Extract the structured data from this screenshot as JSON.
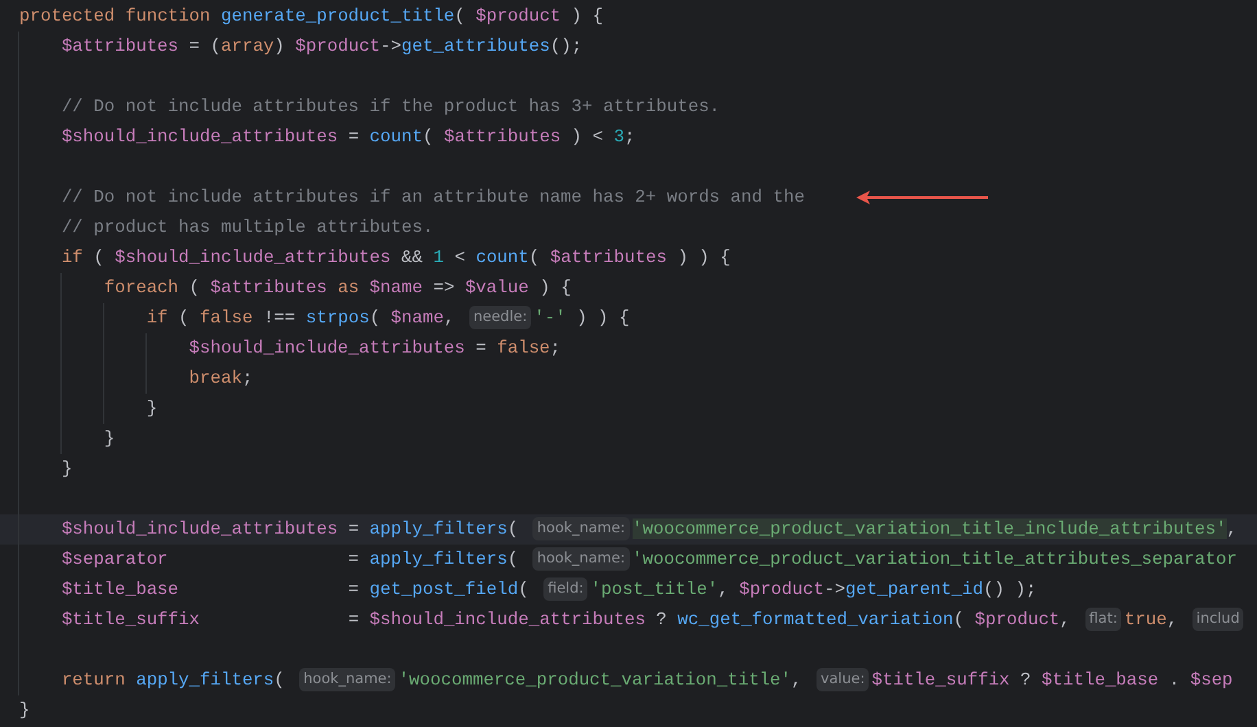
{
  "editor": {
    "lines": [
      {
        "kind": "code",
        "tokens": [
          {
            "kind": "keyword",
            "text": "protected "
          },
          {
            "kind": "keyword",
            "text": "function "
          },
          {
            "kind": "function",
            "text": "generate_product_title"
          },
          {
            "kind": "plain",
            "text": "( "
          },
          {
            "kind": "variable",
            "text": "$product"
          },
          {
            "kind": "plain",
            "text": " ) {"
          }
        ],
        "children": [
          {
            "kind": "code",
            "tokens": [
              {
                "kind": "variable",
                "text": "$attributes"
              },
              {
                "kind": "plain",
                "text": " = ("
              },
              {
                "kind": "keyword",
                "text": "array"
              },
              {
                "kind": "plain",
                "text": ") "
              },
              {
                "kind": "variable",
                "text": "$product"
              },
              {
                "kind": "plain",
                "text": "->"
              },
              {
                "kind": "function",
                "text": "get_attributes"
              },
              {
                "kind": "plain",
                "text": "();"
              }
            ]
          },
          {
            "kind": "blank"
          },
          {
            "kind": "code",
            "tokens": [
              {
                "kind": "comment",
                "text": "// Do not include attributes if the product has 3+ attributes."
              }
            ]
          },
          {
            "kind": "code",
            "tokens": [
              {
                "kind": "variable",
                "text": "$should_include_attributes"
              },
              {
                "kind": "plain",
                "text": " = "
              },
              {
                "kind": "function",
                "text": "count"
              },
              {
                "kind": "plain",
                "text": "( "
              },
              {
                "kind": "variable",
                "text": "$attributes"
              },
              {
                "kind": "plain",
                "text": " ) < "
              },
              {
                "kind": "number",
                "text": "3"
              },
              {
                "kind": "plain",
                "text": ";"
              }
            ]
          },
          {
            "kind": "blank"
          },
          {
            "kind": "code",
            "annotated": true,
            "tokens": [
              {
                "kind": "comment",
                "text": "// Do not include attributes if an attribute name has 2+ words and the"
              }
            ]
          },
          {
            "kind": "code",
            "tokens": [
              {
                "kind": "comment",
                "text": "// product has multiple attributes."
              }
            ]
          },
          {
            "kind": "code",
            "tokens": [
              {
                "kind": "keyword",
                "text": "if"
              },
              {
                "kind": "plain",
                "text": " ( "
              },
              {
                "kind": "variable",
                "text": "$should_include_attributes"
              },
              {
                "kind": "plain",
                "text": " && "
              },
              {
                "kind": "number",
                "text": "1"
              },
              {
                "kind": "plain",
                "text": " < "
              },
              {
                "kind": "function",
                "text": "count"
              },
              {
                "kind": "plain",
                "text": "( "
              },
              {
                "kind": "variable",
                "text": "$attributes"
              },
              {
                "kind": "plain",
                "text": " ) ) {"
              }
            ],
            "children": [
              {
                "kind": "code",
                "tokens": [
                  {
                    "kind": "keyword",
                    "text": "foreach"
                  },
                  {
                    "kind": "plain",
                    "text": " ( "
                  },
                  {
                    "kind": "variable",
                    "text": "$attributes "
                  },
                  {
                    "kind": "keyword",
                    "text": "as "
                  },
                  {
                    "kind": "variable",
                    "text": "$name"
                  },
                  {
                    "kind": "plain",
                    "text": " => "
                  },
                  {
                    "kind": "variable",
                    "text": "$value"
                  },
                  {
                    "kind": "plain",
                    "text": " ) {"
                  }
                ],
                "children": [
                  {
                    "kind": "code",
                    "tokens": [
                      {
                        "kind": "keyword",
                        "text": "if"
                      },
                      {
                        "kind": "plain",
                        "text": " ( "
                      },
                      {
                        "kind": "keyword",
                        "text": "false"
                      },
                      {
                        "kind": "plain",
                        "text": " !== "
                      },
                      {
                        "kind": "function",
                        "text": "strpos"
                      },
                      {
                        "kind": "plain",
                        "text": "( "
                      },
                      {
                        "kind": "variable",
                        "text": "$name"
                      },
                      {
                        "kind": "plain",
                        "text": ", "
                      },
                      {
                        "kind": "hint",
                        "text": "needle:"
                      },
                      {
                        "kind": "string",
                        "text": "'-'"
                      },
                      {
                        "kind": "plain",
                        "text": " ) ) {"
                      }
                    ],
                    "children": [
                      {
                        "kind": "code",
                        "tokens": [
                          {
                            "kind": "variable",
                            "text": "$should_include_attributes"
                          },
                          {
                            "kind": "plain",
                            "text": " = "
                          },
                          {
                            "kind": "keyword",
                            "text": "false"
                          },
                          {
                            "kind": "plain",
                            "text": ";"
                          }
                        ]
                      },
                      {
                        "kind": "code",
                        "tokens": [
                          {
                            "kind": "keyword",
                            "text": "break"
                          },
                          {
                            "kind": "plain",
                            "text": ";"
                          }
                        ]
                      }
                    ]
                  },
                  {
                    "kind": "code",
                    "tokens": [
                      {
                        "kind": "plain",
                        "text": "}"
                      }
                    ]
                  }
                ]
              },
              {
                "kind": "code",
                "tokens": [
                  {
                    "kind": "plain",
                    "text": "}"
                  }
                ]
              }
            ]
          },
          {
            "kind": "code",
            "tokens": [
              {
                "kind": "plain",
                "text": "}"
              }
            ]
          },
          {
            "kind": "blank"
          },
          {
            "kind": "code",
            "current": true,
            "tokens": [
              {
                "kind": "variable",
                "text": "$should_include_attributes"
              },
              {
                "kind": "plain",
                "text": " = "
              },
              {
                "kind": "function",
                "text": "apply_filters"
              },
              {
                "kind": "plain",
                "text": "( "
              },
              {
                "kind": "hint",
                "text": "hook_name:"
              },
              {
                "kind": "string",
                "text": "'woocommerce_product_variation_title_include_attributes'",
                "highlighted": true
              },
              {
                "kind": "plain",
                "text": ","
              }
            ]
          },
          {
            "kind": "code",
            "tokens": [
              {
                "kind": "variable",
                "text": "$separator"
              },
              {
                "kind": "plain",
                "text": "                 = "
              },
              {
                "kind": "function",
                "text": "apply_filters"
              },
              {
                "kind": "plain",
                "text": "( "
              },
              {
                "kind": "hint",
                "text": "hook_name:"
              },
              {
                "kind": "string",
                "text": "'woocommerce_product_variation_title_attributes_separator"
              }
            ]
          },
          {
            "kind": "code",
            "tokens": [
              {
                "kind": "variable",
                "text": "$title_base"
              },
              {
                "kind": "plain",
                "text": "                = "
              },
              {
                "kind": "function",
                "text": "get_post_field"
              },
              {
                "kind": "plain",
                "text": "( "
              },
              {
                "kind": "hint",
                "text": "field:"
              },
              {
                "kind": "string",
                "text": "'post_title'"
              },
              {
                "kind": "plain",
                "text": ", "
              },
              {
                "kind": "variable",
                "text": "$product"
              },
              {
                "kind": "plain",
                "text": "->"
              },
              {
                "kind": "function",
                "text": "get_parent_id"
              },
              {
                "kind": "plain",
                "text": "() );"
              }
            ]
          },
          {
            "kind": "code",
            "tokens": [
              {
                "kind": "variable",
                "text": "$title_suffix"
              },
              {
                "kind": "plain",
                "text": "              = "
              },
              {
                "kind": "variable",
                "text": "$should_include_attributes"
              },
              {
                "kind": "plain",
                "text": " ? "
              },
              {
                "kind": "function",
                "text": "wc_get_formatted_variation"
              },
              {
                "kind": "plain",
                "text": "( "
              },
              {
                "kind": "variable",
                "text": "$product"
              },
              {
                "kind": "plain",
                "text": ", "
              },
              {
                "kind": "hint",
                "text": "flat:"
              },
              {
                "kind": "keyword",
                "text": "true"
              },
              {
                "kind": "plain",
                "text": ", "
              },
              {
                "kind": "hint",
                "text": "includ"
              }
            ]
          },
          {
            "kind": "blank"
          },
          {
            "kind": "code",
            "tokens": [
              {
                "kind": "keyword",
                "text": "return "
              },
              {
                "kind": "function",
                "text": "apply_filters"
              },
              {
                "kind": "plain",
                "text": "( "
              },
              {
                "kind": "hint",
                "text": "hook_name:"
              },
              {
                "kind": "string",
                "text": "'woocommerce_product_variation_title'"
              },
              {
                "kind": "plain",
                "text": ", "
              },
              {
                "kind": "hint",
                "text": "value:"
              },
              {
                "kind": "variable",
                "text": "$title_suffix"
              },
              {
                "kind": "plain",
                "text": " ? "
              },
              {
                "kind": "variable",
                "text": "$title_base"
              },
              {
                "kind": "plain",
                "text": " . "
              },
              {
                "kind": "variable",
                "text": "$sep"
              }
            ]
          }
        ]
      },
      {
        "kind": "code",
        "tokens": [
          {
            "kind": "plain",
            "text": "}"
          }
        ]
      }
    ]
  }
}
